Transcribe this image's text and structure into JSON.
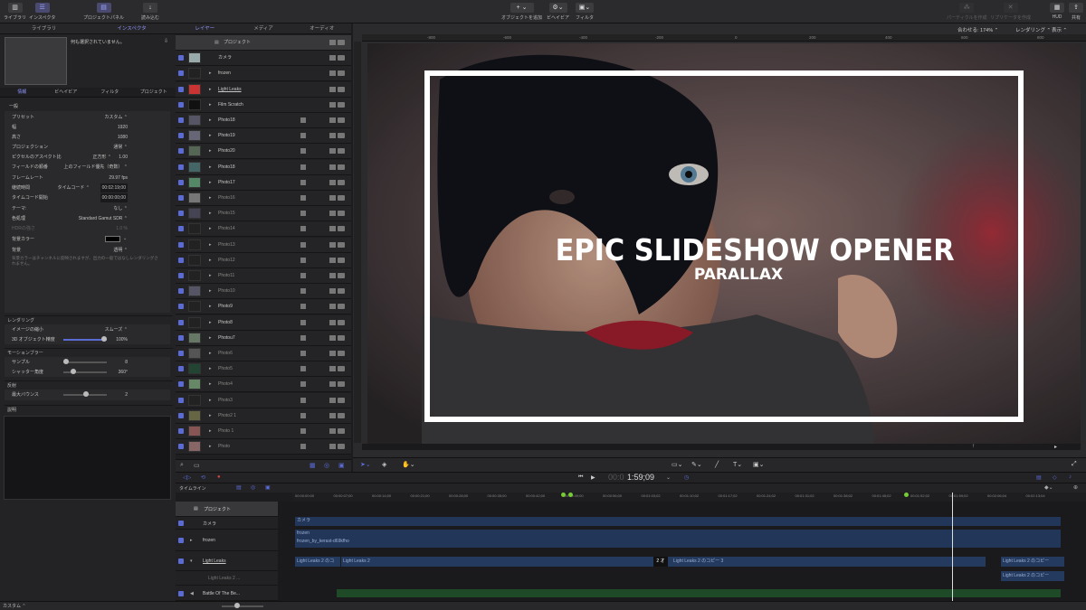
{
  "toolbar": {
    "library": "ライブラリ",
    "inspector": "インスペクタ",
    "project_panel": "プロジェクトパネル",
    "import": "読み込む",
    "add_object": "オブジェクトを追加",
    "behaviors": "ビヘイビア",
    "filters": "フィルタ",
    "hud": "HUD",
    "share": "共有",
    "make_particles": "パーティクルを作成",
    "make_replicator": "リプリケータを作成"
  },
  "left_tabs": {
    "library": "ライブラリ",
    "inspector": "インスペクタ"
  },
  "inspector": {
    "no_selection": "何も選択されていません。",
    "tabs": [
      "情報",
      "ビヘイビア",
      "フィルタ",
      "プロジェクト"
    ],
    "general": "一般",
    "props": [
      {
        "label": "プリセット",
        "value": "カスタム ⌃"
      },
      {
        "label": "幅",
        "value": "1920"
      },
      {
        "label": "高さ",
        "value": "1080"
      },
      {
        "label": "プロジェクション",
        "value": "通常 ⌃"
      },
      {
        "label": "ピクセルのアスペクト比",
        "value": "正方形 ⌃",
        "value2": "1.00"
      },
      {
        "label": "フィールドの順番",
        "value": "上のフィールド優先（奇数） ⌃"
      },
      {
        "label": "フレームレート",
        "value": "29.97 fps"
      },
      {
        "label": "継続時間",
        "value": "タイムコード ⌃",
        "value2": "00:02:19;00"
      },
      {
        "label": "タイムコード開始",
        "value": "00:00:00;00"
      },
      {
        "label": "テーマ:",
        "value": "なし ⌃"
      },
      {
        "label": "色処理",
        "value": "Standard Gamut SDR ⌃"
      }
    ],
    "hdr_label": "HDRの強さ",
    "hdr_value": "1.0 %",
    "bg_color": "背景カラー",
    "background": "背景",
    "background_value": "透明 ⌃",
    "bg_note": "背景カラーはチャンネルに反映されますが、出力の一般ではなしレンダリングされません。",
    "rendering": "レンダリング",
    "image_reduction": "イメージの縮小",
    "image_reduction_value": "スムーズ ⌃",
    "obj_3d": "3D オブジェクト精度",
    "obj_3d_value": "100%",
    "obj_3d_level": 1.0,
    "motion_blur": "モーションブラー",
    "samples": "サンプル",
    "samples_value": "8",
    "shutter": "シャッター角度",
    "shutter_value": "360°",
    "reflection": "反射",
    "max_bounce": "最大バウンス",
    "max_bounce_value": "2",
    "description": "説明"
  },
  "layers_tabs": {
    "layers": "レイヤー",
    "media": "メディア",
    "audio": "オーディオ"
  },
  "layers": [
    {
      "name": "プロジェクト",
      "type": "project"
    },
    {
      "name": "カメラ",
      "type": "camera",
      "color": "#9aa"
    },
    {
      "name": "frozen",
      "type": "group",
      "color": "#222"
    },
    {
      "name": "Light Leaks",
      "type": "group",
      "ul": true,
      "color": "#c33"
    },
    {
      "name": "Film Scratch",
      "type": "group",
      "color": "#111"
    },
    {
      "name": "Photo18",
      "type": "photo",
      "color": "#556"
    },
    {
      "name": "Photo19",
      "type": "photo",
      "color": "#667"
    },
    {
      "name": "Photo20",
      "type": "photo",
      "color": "#565"
    },
    {
      "name": "Photo18",
      "type": "photo",
      "color": "#466"
    },
    {
      "name": "Photo17",
      "type": "photo",
      "color": "#586"
    },
    {
      "name": "Photo16",
      "type": "photo",
      "dim": true,
      "color": "#777"
    },
    {
      "name": "Photo15",
      "type": "photo",
      "dim": true,
      "color": "#445"
    },
    {
      "name": "Photo14",
      "type": "photo",
      "dim": true,
      "color": "#222"
    },
    {
      "name": "Photo13",
      "type": "photo",
      "dim": true,
      "color": "#222"
    },
    {
      "name": "Photo12",
      "type": "photo",
      "dim": true,
      "color": "#222"
    },
    {
      "name": "Photo11",
      "type": "photo",
      "dim": true,
      "color": "#222"
    },
    {
      "name": "Photo10",
      "type": "photo",
      "dim": true,
      "color": "#556"
    },
    {
      "name": "Photo9",
      "type": "photo",
      "color": "#222"
    },
    {
      "name": "Photo8",
      "type": "photo",
      "color": "#222"
    },
    {
      "name": "Photou7",
      "type": "photo",
      "color": "#676"
    },
    {
      "name": "Photo6",
      "type": "photo",
      "dim": true,
      "color": "#555"
    },
    {
      "name": "Photo5",
      "type": "photo",
      "dim": true,
      "color": "#243"
    },
    {
      "name": "Photo4",
      "type": "photo",
      "dim": true,
      "color": "#686"
    },
    {
      "name": "Photo3",
      "type": "photo",
      "dim": true,
      "color": "#222"
    },
    {
      "name": "Photo2 1",
      "type": "photo",
      "dim": true,
      "color": "#664"
    },
    {
      "name": "Photo 1",
      "type": "photo",
      "dim": true,
      "color": "#855"
    },
    {
      "name": "Photo",
      "type": "photo",
      "dim": true,
      "color": "#866"
    }
  ],
  "canvas": {
    "fit": "合わせる: 174% ⌃",
    "render": "レンダリング ⌃",
    "view": "表示 ⌃",
    "ruler_ticks": [
      "-800",
      "-600",
      "-400",
      "-200",
      "0",
      "200",
      "400",
      "600",
      "800"
    ],
    "title": "EPIC SLIDESHOW OPENER",
    "subtitle": "PARALLAX"
  },
  "transport": {
    "timecode_dim": "00:0",
    "timecode": "1:59;09"
  },
  "timeline": {
    "label": "タイムライン",
    "ticks": [
      "00:00:00:00",
      "00:00:07;00",
      "00:00:14;00",
      "00:00:21;00",
      "00:00:28;00",
      "00:00:35;00",
      "00:00:42;00",
      "00:00:49;00",
      "00:00:56;00",
      "00:01:03;02",
      "00:01:10;02",
      "00:01:17;02",
      "00:01:24;02",
      "00:01:31;02",
      "00:01:38;02",
      "00:01:45;02",
      "00:01:52;02",
      "00:01:59;02",
      "00:02:06;04",
      "00:02:13;04"
    ],
    "tracks": [
      "プロジェクト",
      "カメラ",
      "frozen",
      "Light Leaks",
      "Light Leaks 2 ...",
      "Battle Of The Be..."
    ],
    "bars": {
      "camera": "カメラ",
      "frozen": "frozen",
      "frozen2": "frozen_by_kerast-d69kfho",
      "ll1": "Light Leaks 2 のコ",
      "ll2": "Light Leaks 2",
      "ll3": "Light Leaks 2 のコピー 3",
      "ll4": "Light Leaks 2 のコピー",
      "ll5": "Light Leaks 2 のコピー",
      "badge": "2 オ"
    }
  },
  "status": {
    "custom": "カスタム ⌃"
  },
  "colors": {
    "accent": "#5a6bd6",
    "bar_blue": "#213659",
    "bar_green": "#1f4a27"
  }
}
